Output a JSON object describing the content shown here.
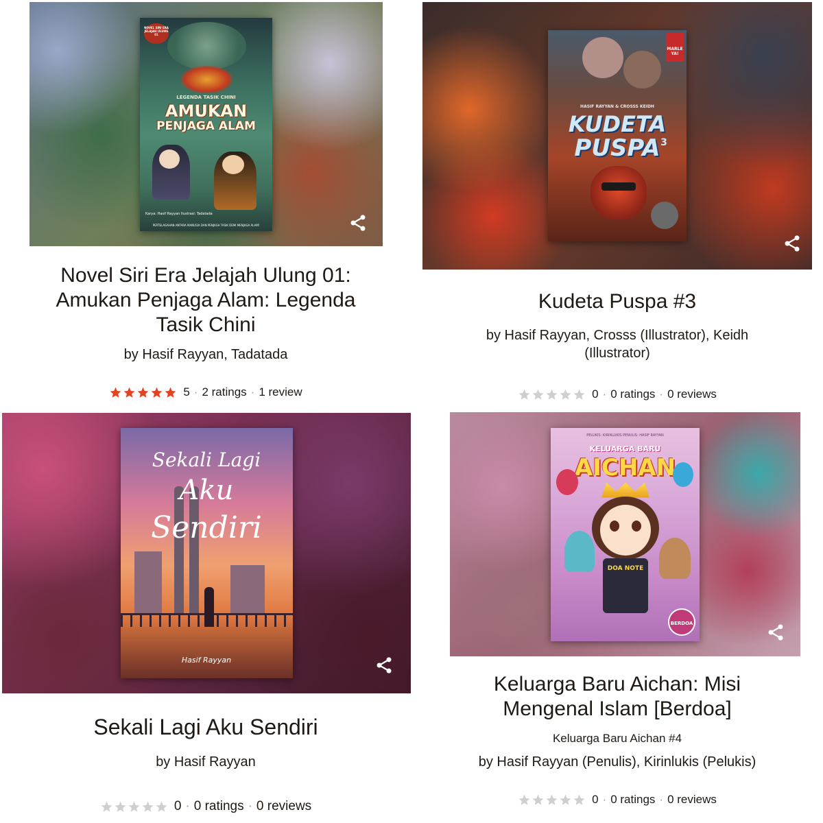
{
  "books": [
    {
      "title": "Novel Siri Era Jelajah Ulung 01: Amukan Penjaga Alam: Legenda Tasik Chini",
      "byline": "by Hasif Rayyan, Tadatada",
      "rating": {
        "stars": 5,
        "score": "5",
        "ratings": "2 ratings",
        "reviews": "1 review"
      },
      "cover": {
        "top": "LEGENDA TASIK CHINI",
        "line1": "AMUKAN",
        "line2": "PENJAGA ALAM",
        "badge": "NOVEL SIRI ERA JELAJAH ULUNG 01",
        "credits": "Karya: Hasif Rayyan  Ilustrasi: Tadatada",
        "footer": "PERTELAGAHAN ANTARA MANUSIA DAN PENJAGA TASIK DEMI MENJAGA ALAM!"
      }
    },
    {
      "title": "Kudeta Puspa #3",
      "byline": "by Hasif Rayyan, Crosss (Illustrator), Keidh (Illustrator)",
      "rating": {
        "stars": 0,
        "score": "0",
        "ratings": "0 ratings",
        "reviews": "0 reviews"
      },
      "cover": {
        "line1": "KUDETA",
        "line2": "PUSPA",
        "num": "3",
        "credits": "HASIF RAYYAN & CROSSS KEIDH",
        "publisher": "MARLE YA!"
      }
    },
    {
      "title": "Sekali Lagi Aku Sendiri",
      "byline": "by Hasif Rayyan",
      "rating": {
        "stars": 0,
        "score": "0",
        "ratings": "0 ratings",
        "reviews": "0 reviews"
      },
      "cover": {
        "line1": "Sekali Lagi",
        "line2": "Aku",
        "line3": "Sendiri",
        "author": "Hasif Rayyan"
      }
    },
    {
      "title": "Keluarga Baru Aichan: Misi Mengenal Islam [Berdoa]",
      "series": "Keluarga Baru Aichan #4",
      "byline": "by Hasif Rayyan (Penulis), Kirinlukis (Pelukis)",
      "rating": {
        "stars": 0,
        "score": "0",
        "ratings": "0 ratings",
        "reviews": "0 reviews"
      },
      "cover": {
        "top": "PELUKIS: KIRINLUKIS   PENULIS: HASIF RAYYAN",
        "line1": "KELUARGA BARU",
        "line2": "AICHAN",
        "book": "DOA NOTE",
        "badge": "BERDOA"
      }
    }
  ],
  "colors": {
    "star_filled": "#e8411e",
    "star_empty": "#cfcfcf",
    "text": "#1e1915"
  }
}
